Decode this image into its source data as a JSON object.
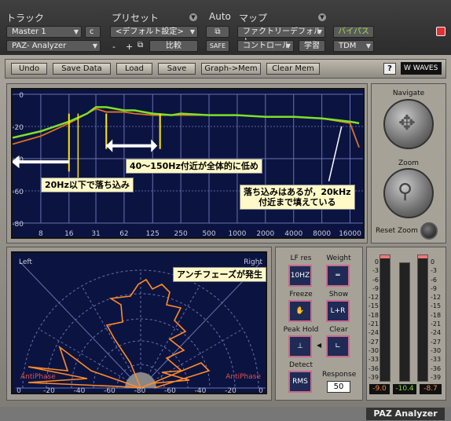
{
  "header": {
    "track_label": "トラック",
    "preset_label": "プリセット",
    "auto_label": "Auto",
    "map_label": "マップ",
    "track": "Master 1",
    "track_c": "c",
    "plugin": "PAZ- Analyzer",
    "preset": "<デフォルト設定>",
    "preset_minus": "-",
    "preset_plus": "+",
    "compare": "比較",
    "safe": "SAFE",
    "map": "ファクトリーデフォルト",
    "control": "コントロール",
    "learn": "学習",
    "bypass": "バイパス",
    "tdm": "TDM"
  },
  "toolbar": {
    "undo": "Undo",
    "save_data": "Save Data",
    "load": "Load",
    "save": "Save",
    "graph_mem": "Graph->Mem",
    "clear_mem": "Clear Mem",
    "help": "?",
    "logo": "WAVES"
  },
  "spectrum": {
    "y_ticks": [
      "0",
      "-20",
      "-40",
      "-60",
      "-80"
    ],
    "x_ticks": [
      "8",
      "16",
      "31",
      "62",
      "125",
      "250",
      "500",
      "1000",
      "2000",
      "4000",
      "8000",
      "16000"
    ]
  },
  "annotations": {
    "low_cut": "20Hz以下で落ち込み",
    "mid_low": "40〜150Hz付近が全体的に低め",
    "high": "落ち込みはあるが，20kHz\n付近まで填えている",
    "anti": "アンチフェーズが発生"
  },
  "navigate": {
    "label": "Navigate",
    "zoom": "Zoom",
    "reset": "Reset Zoom"
  },
  "polar": {
    "left": "Left",
    "right": "Right",
    "anti_l": "AntiPhase",
    "anti_r": "AntiPhase",
    "ticks": [
      "0",
      "-20",
      "-40",
      "-60",
      "-80",
      "-60",
      "-40",
      "-20",
      "0"
    ]
  },
  "controls": {
    "lf_res": "LF res",
    "lf_val": "10HZ",
    "weight": "Weight",
    "freeze": "Freeze",
    "show": "Show",
    "show_val": "L+R",
    "peak_hold": "Peak Hold",
    "clear": "Clear",
    "detect": "Detect",
    "detect_val": "RMS",
    "response": "Response",
    "response_val": "50"
  },
  "meters": {
    "scale": [
      "0",
      "-3",
      "-6",
      "-9",
      "-12",
      "-15",
      "-18",
      "-21",
      "-24",
      "-27",
      "-30",
      "-33",
      "-36",
      "-39"
    ],
    "left": "-9.0",
    "center": "-10.4",
    "right": "-8.7"
  },
  "footer": {
    "title": "PAZ Analyzer"
  },
  "chart_data": {
    "type": "line",
    "title": "",
    "xlabel": "",
    "ylabel": "",
    "x_scale": "log",
    "x": [
      4,
      8,
      16,
      25,
      31,
      40,
      62,
      80,
      125,
      200,
      250,
      500,
      1000,
      2000,
      4000,
      8000,
      16000,
      20000
    ],
    "series": [
      {
        "name": "",
        "color": "#7fe02a",
        "values": [
          -27,
          -23,
          -17,
          -12,
          -8,
          -8,
          -10,
          -10,
          -12,
          -13,
          -12,
          -13,
          -13,
          -14,
          -14,
          -15,
          -17,
          -18
        ]
      },
      {
        "name": "",
        "color": "#e07020",
        "values": [
          -31,
          -26,
          -18,
          -12,
          -9,
          -11,
          -11,
          -12,
          -13,
          -13,
          -13,
          -13,
          -13,
          -14,
          -14,
          -15,
          -18,
          -33
        ]
      }
    ],
    "ylim": [
      -80,
      0
    ],
    "xlim": [
      4,
      22000
    ],
    "grid": true
  }
}
